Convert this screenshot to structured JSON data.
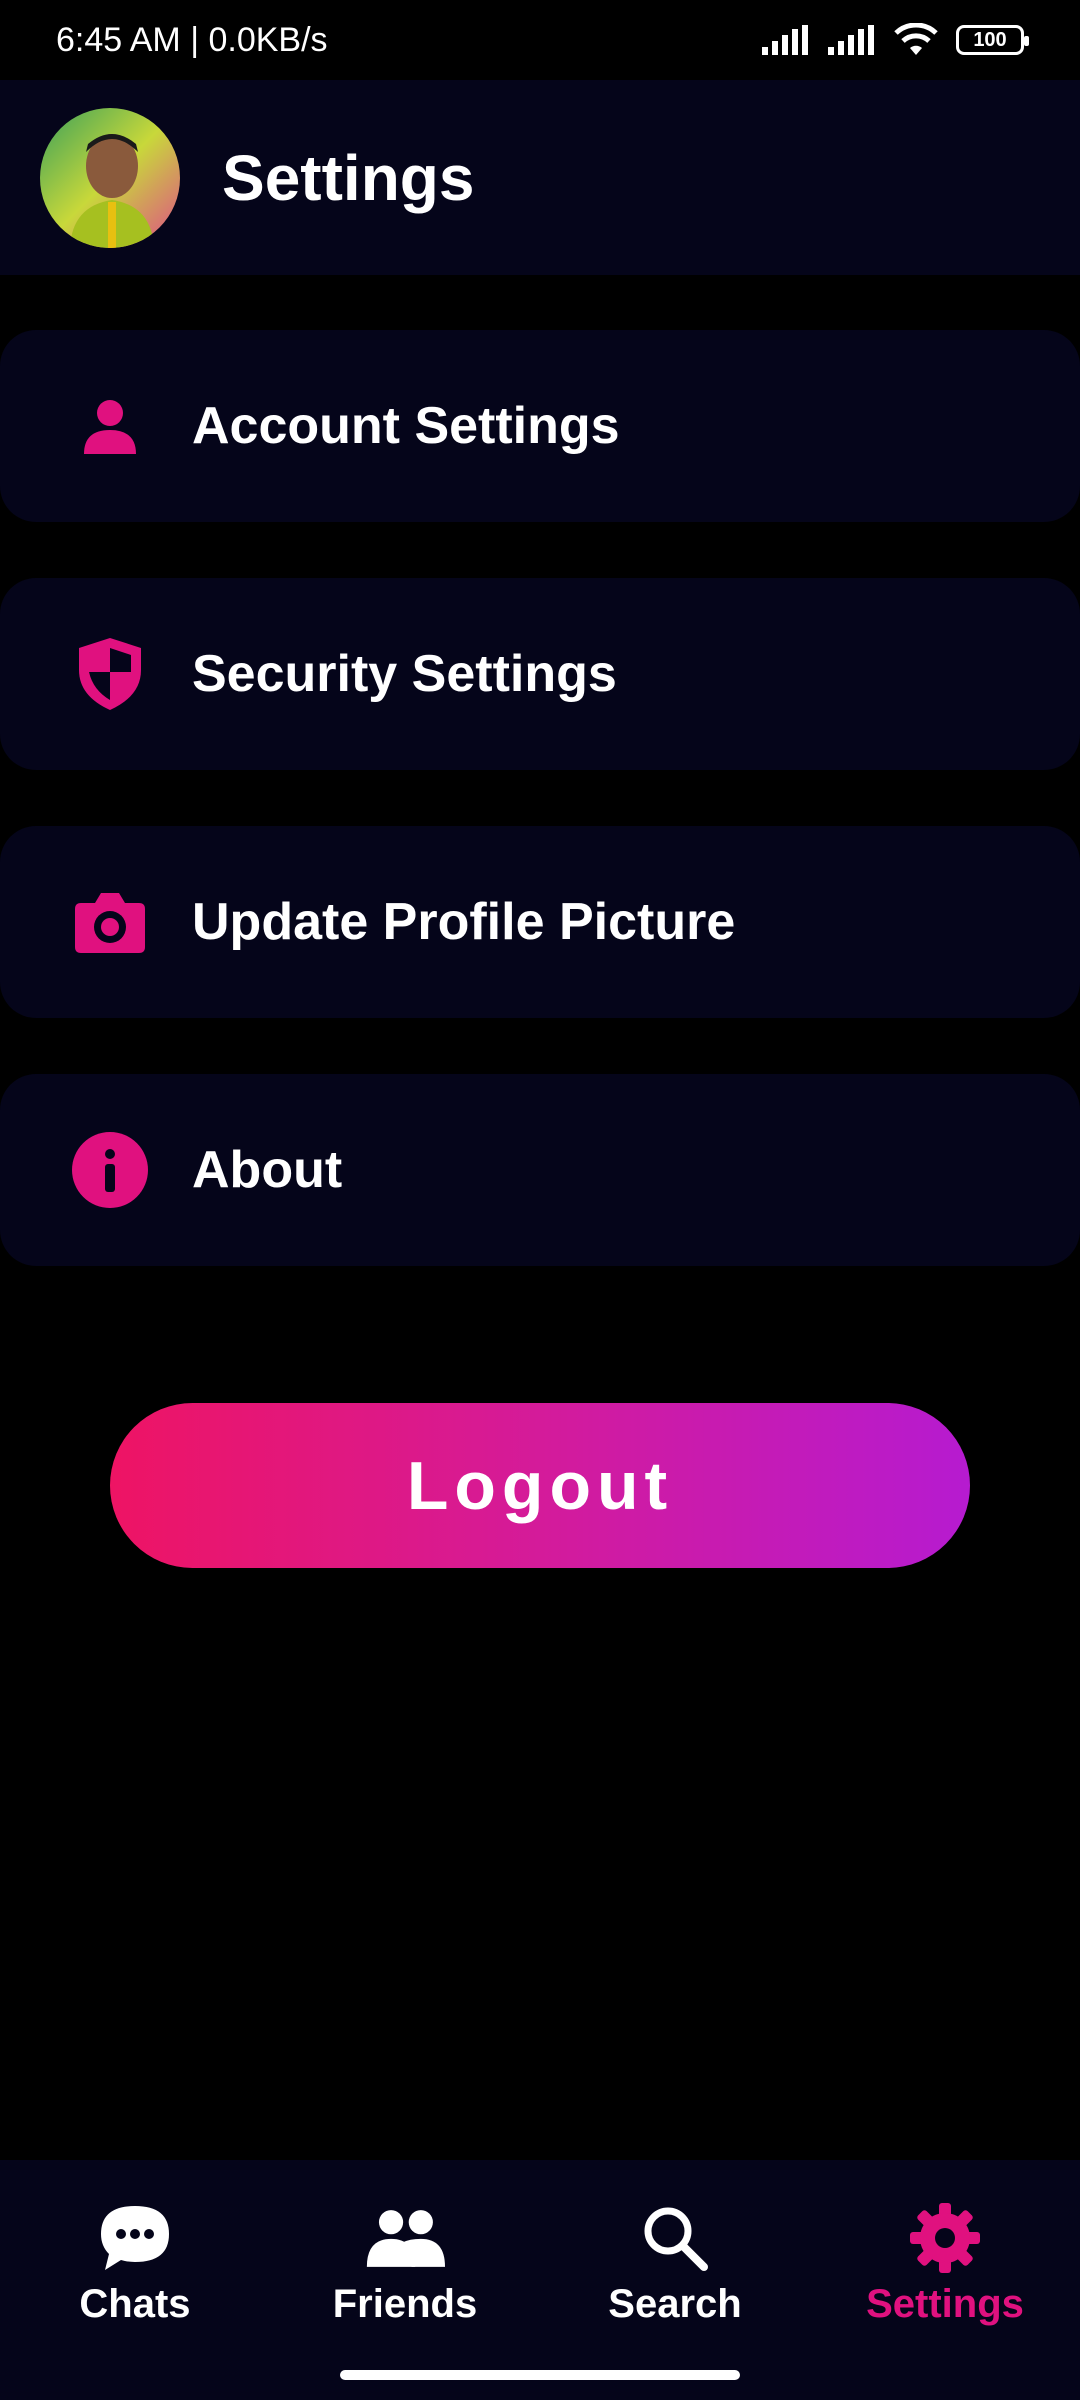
{
  "status_bar": {
    "time_speed": "6:45 AM | 0.0KB/s",
    "battery": "100"
  },
  "header": {
    "title": "Settings",
    "avatar_icon": "profile-photo"
  },
  "menu": {
    "items": [
      {
        "label": "Account Settings",
        "icon": "person-icon"
      },
      {
        "label": "Security Settings",
        "icon": "shield-icon"
      },
      {
        "label": "Update Profile Picture",
        "icon": "camera-icon"
      },
      {
        "label": "About",
        "icon": "info-icon"
      }
    ]
  },
  "logout": {
    "label": "Logout"
  },
  "bottom_nav": {
    "items": [
      {
        "label": "Chats",
        "icon": "chat-bubble-icon",
        "active": false
      },
      {
        "label": "Friends",
        "icon": "people-icon",
        "active": false
      },
      {
        "label": "Search",
        "icon": "search-icon",
        "active": false
      },
      {
        "label": "Settings",
        "icon": "gear-icon",
        "active": true
      }
    ]
  },
  "colors": {
    "accent": "#e0117f",
    "surface": "#05051a",
    "background": "#000000",
    "gradient_start": "#ee1464",
    "gradient_end": "#b61bd0"
  }
}
